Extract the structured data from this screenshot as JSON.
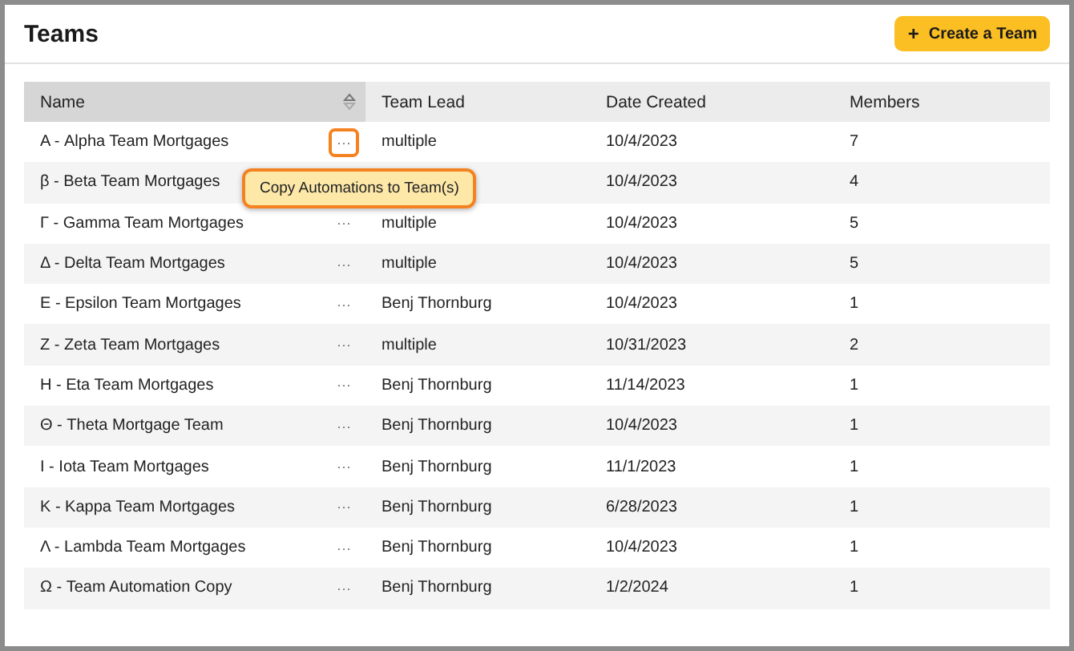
{
  "page": {
    "title": "Teams",
    "create_button": {
      "icon": "+",
      "label": "Create a Team"
    }
  },
  "table": {
    "columns": [
      {
        "label": "Name",
        "sorted": true
      },
      {
        "label": "Team Lead",
        "sorted": false
      },
      {
        "label": "Date Created",
        "sorted": false
      },
      {
        "label": "Members",
        "sorted": false
      }
    ],
    "rows": [
      {
        "name": "Α - Alpha Team Mortgages",
        "actions": "···",
        "menu_open": true,
        "lead": "multiple",
        "date": "10/4/2023",
        "members": "7"
      },
      {
        "name": "β - Beta Team Mortgages",
        "date": "10/4/2023",
        "members": "4"
      },
      {
        "name": "Γ - Gamma Team Mortgages",
        "actions": "···",
        "menu_open": false,
        "lead": "multiple",
        "date": "10/4/2023",
        "members": "5"
      },
      {
        "name": "Δ - Delta Team Mortgages",
        "actions": "···",
        "menu_open": false,
        "lead": "multiple",
        "date": "10/4/2023",
        "members": "5"
      },
      {
        "name": "Ε - Epsilon Team Mortgages",
        "actions": "···",
        "menu_open": false,
        "lead": "Benj Thornburg",
        "date": "10/4/2023",
        "members": "1"
      },
      {
        "name": "Ζ - Zeta Team Mortgages",
        "actions": "···",
        "menu_open": false,
        "lead": "multiple",
        "date": "10/31/2023",
        "members": "2"
      },
      {
        "name": "Η - Eta Team Mortgages",
        "actions": "···",
        "menu_open": false,
        "lead": "Benj Thornburg",
        "date": "11/14/2023",
        "members": "1"
      },
      {
        "name": "Θ - Theta Mortgage Team",
        "actions": "···",
        "menu_open": false,
        "lead": "Benj Thornburg",
        "date": "10/4/2023",
        "members": "1"
      },
      {
        "name": "Ι - Iota Team Mortgages",
        "actions": "···",
        "menu_open": false,
        "lead": "Benj Thornburg",
        "date": "11/1/2023",
        "members": "1"
      },
      {
        "name": "Κ - Kappa Team Mortgages",
        "actions": "···",
        "menu_open": false,
        "lead": "Benj Thornburg",
        "date": "6/28/2023",
        "members": "1"
      },
      {
        "name": "Λ - Lambda Team Mortgages",
        "actions": "···",
        "menu_open": false,
        "lead": "Benj Thornburg",
        "date": "10/4/2023",
        "members": "1"
      },
      {
        "name": "Ω - Team Automation Copy",
        "actions": "···",
        "menu_open": false,
        "lead": "Benj Thornburg",
        "date": "1/2/2024",
        "members": "1"
      }
    ]
  },
  "popup_menu": {
    "label": "Copy Automations to Team(s)"
  }
}
